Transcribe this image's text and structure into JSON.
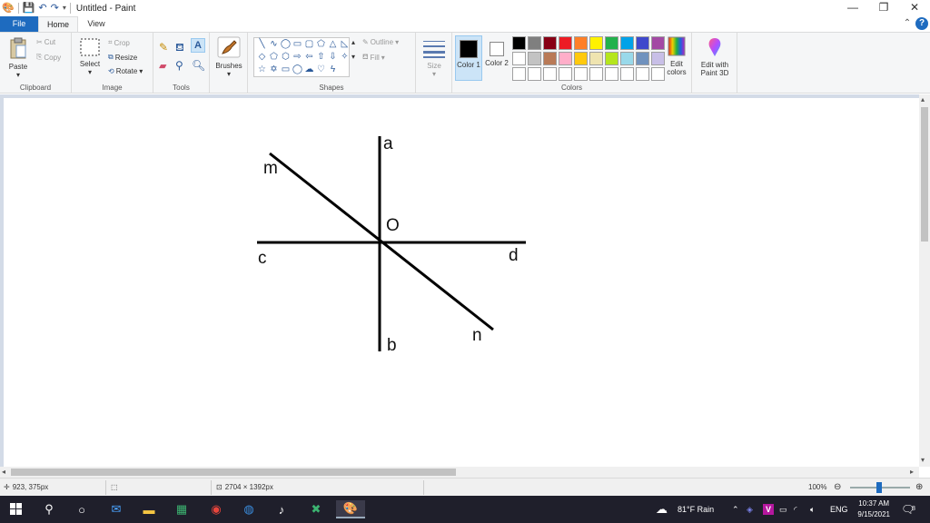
{
  "window": {
    "title": "Untitled - Paint",
    "minimize": "—",
    "maximize": "❐",
    "close": "✕"
  },
  "tabs": {
    "file": "File",
    "home": "Home",
    "view": "View"
  },
  "ribbon": {
    "clipboard": {
      "label": "Clipboard",
      "paste": "Paste",
      "cut": "Cut",
      "copy": "Copy"
    },
    "image": {
      "label": "Image",
      "select": "Select",
      "crop": "Crop",
      "resize": "Resize",
      "rotate": "Rotate"
    },
    "tools": {
      "label": "Tools"
    },
    "brushes": {
      "label": "Brushes"
    },
    "shapes": {
      "label": "Shapes",
      "outline": "Outline",
      "fill": "Fill"
    },
    "size": {
      "label": "Size"
    },
    "colors": {
      "label": "Colors",
      "color1": "Color 1",
      "color2": "Color 2",
      "color1_value": "#000000",
      "color2_value": "#ffffff",
      "edit_colors": "Edit colors",
      "palette": [
        "#000000",
        "#7f7f7f",
        "#880015",
        "#ed1c24",
        "#ff7f27",
        "#fff200",
        "#22b14c",
        "#00a2e8",
        "#3f48cc",
        "#a349a4",
        "#ffffff",
        "#c3c3c3",
        "#b97a57",
        "#ffaec9",
        "#ffc90e",
        "#efe4b0",
        "#b5e61d",
        "#99d9ea",
        "#7092be",
        "#c8bfe7",
        "#ffffff",
        "#ffffff",
        "#ffffff",
        "#ffffff",
        "#ffffff",
        "#ffffff",
        "#ffffff",
        "#ffffff",
        "#ffffff",
        "#ffffff"
      ]
    },
    "paint3d": "Edit with Paint 3D"
  },
  "drawing": {
    "labels": {
      "a": "a",
      "b": "b",
      "c": "c",
      "d": "d",
      "m": "m",
      "n": "n",
      "o": "O"
    }
  },
  "status": {
    "cursor": "923, 375px",
    "canvas_size": "2704 × 1392px",
    "zoom": "100%"
  },
  "taskbar": {
    "weather": "81°F  Rain",
    "lang": "ENG",
    "time": "10:37 AM",
    "date": "9/15/2021",
    "notifications": "8"
  }
}
